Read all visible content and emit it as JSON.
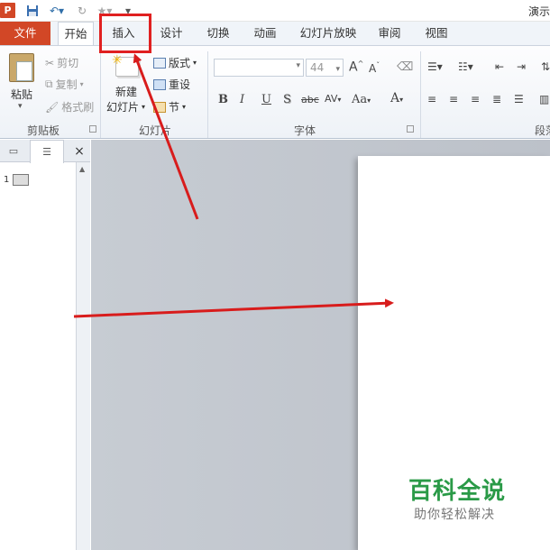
{
  "titlebar": {
    "app_letter": "P",
    "title": "演示",
    "icons": [
      "save-icon",
      "undo-icon",
      "redo-icon",
      "star-icon",
      "customize-qat-icon"
    ]
  },
  "tabs": [
    {
      "label": "文件"
    },
    {
      "label": "开始"
    },
    {
      "label": "插入"
    },
    {
      "label": "设计"
    },
    {
      "label": "切换"
    },
    {
      "label": "动画"
    },
    {
      "label": "幻灯片放映"
    },
    {
      "label": "审阅"
    },
    {
      "label": "视图"
    }
  ],
  "ribbon": {
    "clipboard": {
      "paste": "粘贴",
      "cut": "剪切",
      "copy": "复制",
      "format_painter": "格式刷",
      "label": "剪贴板"
    },
    "slides": {
      "new_slide_line1": "新建",
      "new_slide_line2": "幻灯片",
      "layout": "版式",
      "reset": "重设",
      "section": "节",
      "label": "幻灯片"
    },
    "font": {
      "font_name": "",
      "font_size": "44",
      "bold": "B",
      "italic": "I",
      "underline": "U",
      "shadow": "S",
      "strike": "abc",
      "spacing": "AV",
      "case": "Aa",
      "color": "A",
      "grow": "A",
      "shrink": "A",
      "label": "字体"
    },
    "paragraph": {
      "label": "段落"
    }
  },
  "left_panel": {
    "slide_number": "1",
    "close": "×"
  },
  "watermark": {
    "title": "百科全说",
    "subtitle": "助你轻松解决"
  },
  "colors": {
    "file_tab": "#d24726",
    "annotation": "#e02020",
    "watermark": "#2a9a47"
  }
}
